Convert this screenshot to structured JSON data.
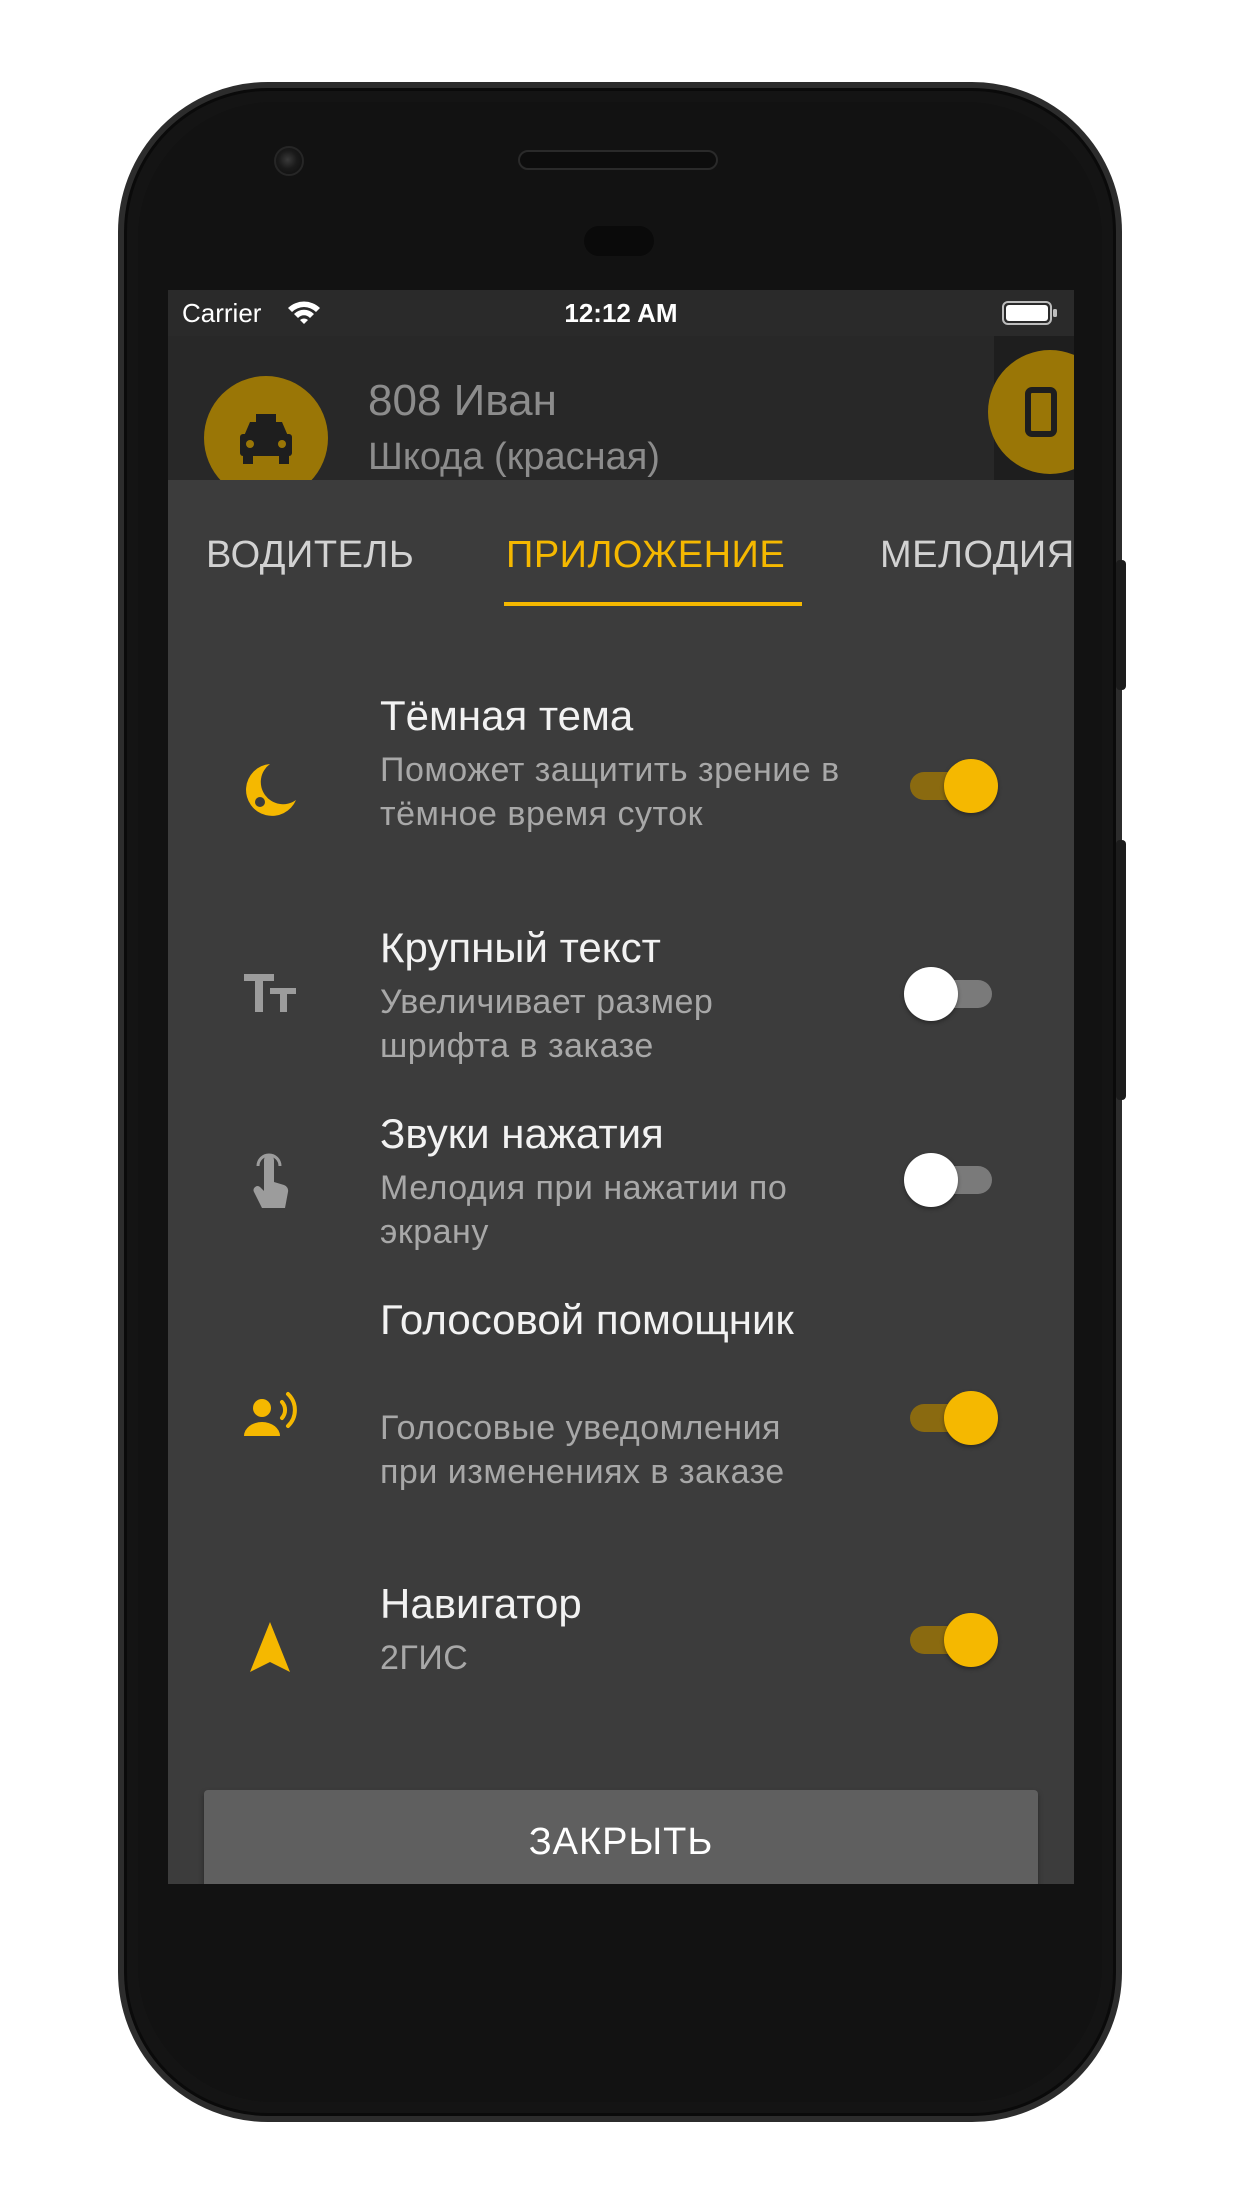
{
  "status_bar": {
    "carrier": "Carrier",
    "time": "12:12 AM"
  },
  "header": {
    "title": "808 Иван",
    "subtitle": "Шкода (красная)"
  },
  "tabs": [
    {
      "label": "ВОДИТЕЛЬ",
      "active": false
    },
    {
      "label": "ПРИЛОЖЕНИЕ",
      "active": true
    },
    {
      "label": "МЕЛОДИЯ",
      "active": false
    }
  ],
  "settings": [
    {
      "title": "Тёмная тема",
      "description": "Поможет защитить зрение в тёмное время суток",
      "icon": "moon-icon",
      "enabled": true
    },
    {
      "title": "Крупный текст",
      "description": "Увеличивает размер шрифта в заказе",
      "icon": "text-size-icon",
      "enabled": false
    },
    {
      "title": "Звуки нажатия",
      "description": "Мелодия при нажатии по экрану",
      "icon": "tap-icon",
      "enabled": false
    },
    {
      "title": "Голосовой помощник",
      "description": "Голосовые уведомления при изменениях в заказе",
      "icon": "voice-assistant-icon",
      "enabled": true
    },
    {
      "title": "Навигатор",
      "description": "2ГИС",
      "icon": "navigation-arrow-icon",
      "enabled": true
    }
  ],
  "close_button": "ЗАКРЫТЬ",
  "colors": {
    "accent": "#f5b800",
    "background": "#3c3c3c",
    "button": "#5f5f5f"
  }
}
